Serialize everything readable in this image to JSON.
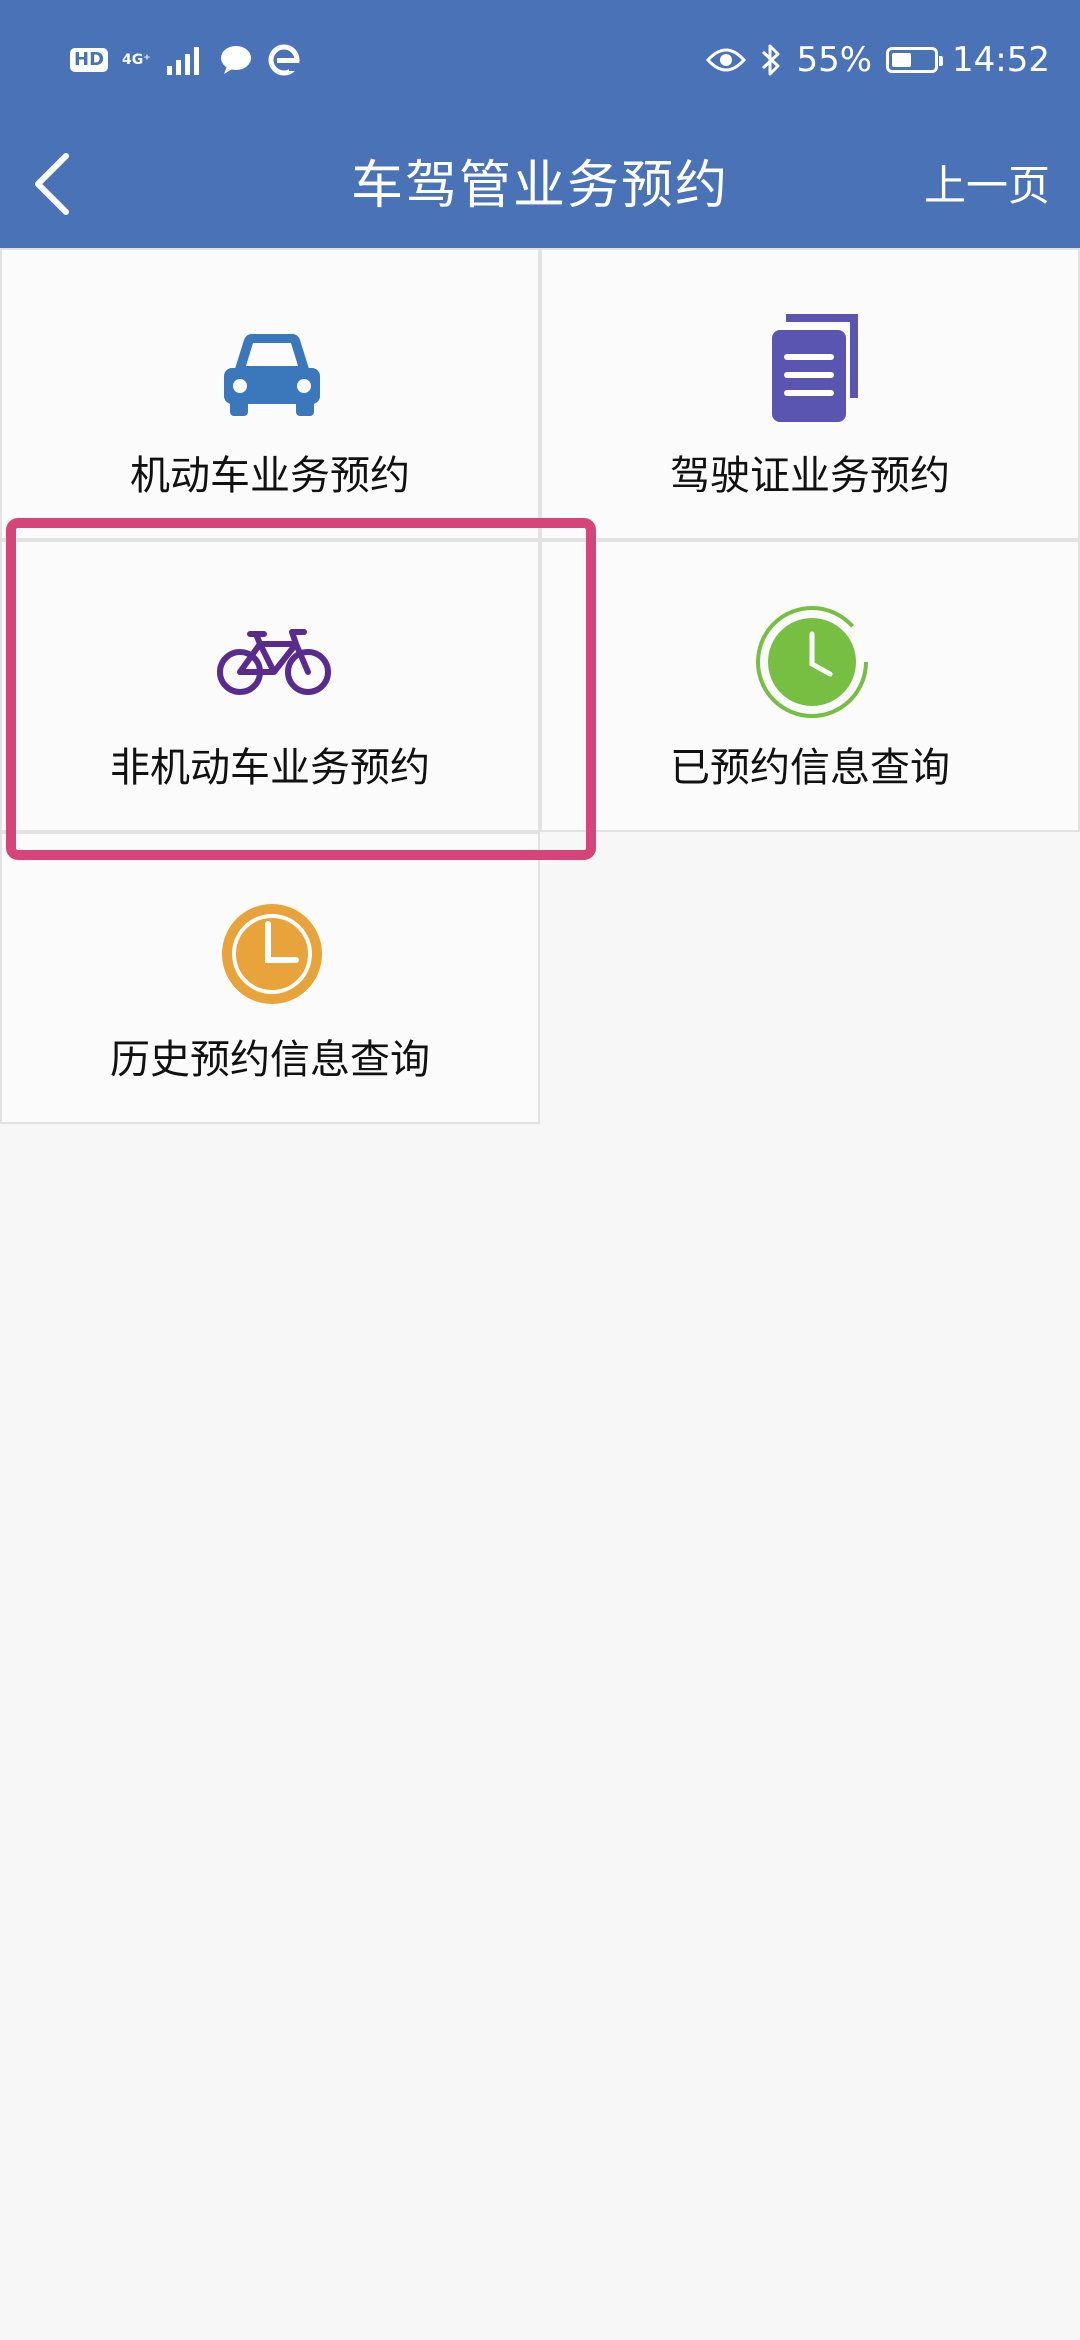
{
  "status_bar": {
    "hd": "HD",
    "network": "4G⁺",
    "battery": "55%",
    "battery_level": 0.55,
    "time": "14:52"
  },
  "header": {
    "title": "车驾管业务预约",
    "prev_label": "上一页"
  },
  "grid": {
    "items": [
      {
        "label": "机动车业务预约",
        "icon": "car-icon",
        "color": "#3b78bb"
      },
      {
        "label": "驾驶证业务预约",
        "icon": "document-icon",
        "color": "#5a55b0"
      },
      {
        "label": "非机动车业务预约",
        "icon": "bicycle-icon",
        "color": "#5a2b8f",
        "highlighted": true
      },
      {
        "label": "已预约信息查询",
        "icon": "clock-icon",
        "color": "#77bf42"
      },
      {
        "label": "历史预约信息查询",
        "icon": "clock-icon",
        "color": "#e8a33b"
      }
    ]
  },
  "colors": {
    "header_bg": "#4a72b6",
    "highlight_border": "#d6457a",
    "page_bg": "#f7f7f7"
  }
}
